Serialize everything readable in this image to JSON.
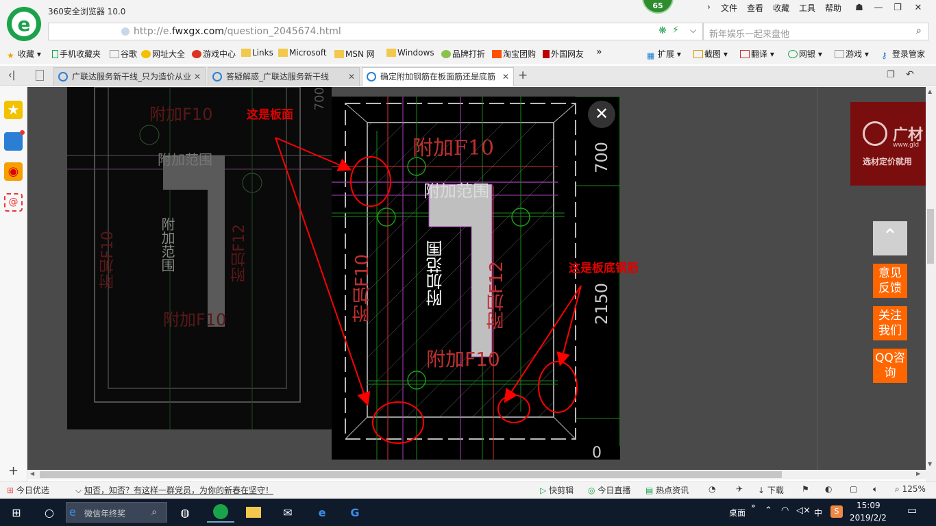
{
  "app": {
    "title": "360安全浏览器 10.0",
    "badge": "65"
  },
  "menu": [
    "文件",
    "查看",
    "收藏",
    "工具",
    "帮助"
  ],
  "address": {
    "prefix": "http://e.",
    "domain": "fwxgx.com",
    "path": "/question_2045674.html"
  },
  "search": {
    "placeholder": "新年娱乐一起来盘他"
  },
  "bookmarks": [
    "收藏",
    "手机收藏夹",
    "谷歌",
    "网址大全",
    "游戏中心",
    "Links",
    "Microsoft",
    "MSN 网",
    "Windows",
    "品牌打折",
    "淘宝团购",
    "外国网友"
  ],
  "right_tools": [
    "扩展",
    "截图",
    "翻译",
    "网银",
    "游戏",
    "登录管家"
  ],
  "tabs": [
    {
      "label": "广联达服务新干线_只为造价从业"
    },
    {
      "label": "答疑解惑_广联达服务新干线"
    },
    {
      "label": "确定附加钢筋在板面筋还是底筋"
    }
  ],
  "drawing": {
    "note1": "这是板面",
    "note2": "这是板底钢筋",
    "cad_labels": {
      "f10_top": "附加F10",
      "range1": "附加范围",
      "range2": "附加范围",
      "f10_left": "附加F10",
      "f12_right": "附加F12",
      "f10_bottom": "附加F10",
      "dim700": "700",
      "dim2150": "2150",
      "dim_bottom": "0"
    },
    "bg_labels": {
      "f10": "附加F10",
      "range1": "附加范围",
      "range2": "附加范围",
      "f10b": "附加F10",
      "f12": "附加F12",
      "f10c": "附加F10",
      "dim": "700"
    }
  },
  "ad": {
    "brand": "广材",
    "url": "www.gld",
    "slogan": "选材定价就用"
  },
  "float_buttons": {
    "feedback": "意见反馈",
    "follow": "关注我们",
    "qq": "QQ咨询"
  },
  "status": {
    "today": "今日优选",
    "news": "知否，知否？有这样一群党员，为你的新春在坚守！",
    "items": [
      "快剪辑",
      "今日直播",
      "热点资讯",
      "下载"
    ],
    "zoom": "125%"
  },
  "taskbar": {
    "search_placeholder": "微信年终奖",
    "desktop": "桌面",
    "ime": "中",
    "time": "15:09",
    "date": "2019/2/2"
  },
  "colors": {
    "accent": "#ff6600",
    "brand_green": "#1aa34a",
    "note_red": "#e00000"
  }
}
